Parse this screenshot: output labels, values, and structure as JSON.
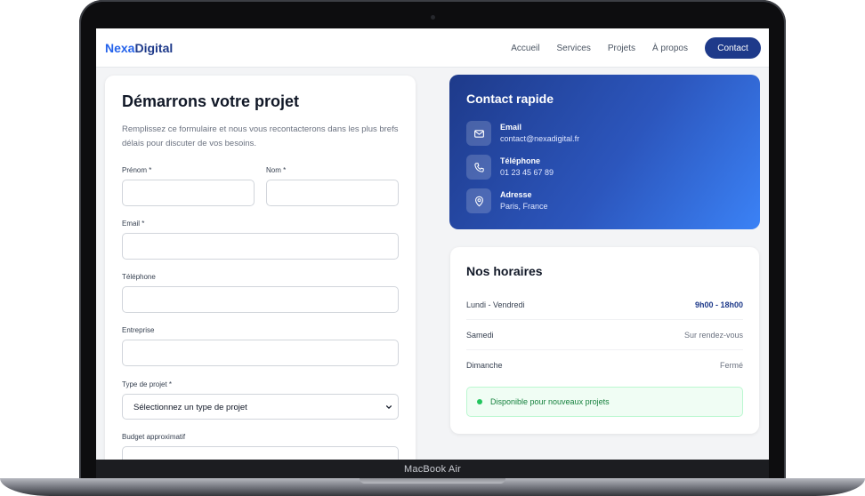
{
  "device": {
    "label": "MacBook Air"
  },
  "nav": {
    "logo_part1": "Nexa",
    "logo_part2": "Digital",
    "links": [
      "Accueil",
      "Services",
      "Projets",
      "À propos"
    ],
    "cta": "Contact"
  },
  "form": {
    "title": "Démarrons votre projet",
    "intro": "Remplissez ce formulaire et nous vous recontacterons dans les plus brefs délais pour discuter de vos besoins.",
    "fields": {
      "prenom": "Prénom *",
      "nom": "Nom *",
      "email": "Email *",
      "telephone": "Téléphone",
      "entreprise": "Entreprise",
      "type_projet": "Type de projet *",
      "budget": "Budget approximatif"
    },
    "type_projet_selected": "Sélectionnez un type de projet"
  },
  "contact": {
    "title": "Contact rapide",
    "items": [
      {
        "icon": "mail-icon",
        "label": "Email",
        "value": "contact@nexadigital.fr"
      },
      {
        "icon": "phone-icon",
        "label": "Téléphone",
        "value": "01 23 45 67 89"
      },
      {
        "icon": "map-pin-icon",
        "label": "Adresse",
        "value": "Paris, France"
      }
    ]
  },
  "hours": {
    "title": "Nos horaires",
    "rows": [
      {
        "day": "Lundi - Vendredi",
        "time": "9h00 - 18h00"
      },
      {
        "day": "Samedi",
        "time": "Sur rendez-vous"
      },
      {
        "day": "Dimanche",
        "time": "Fermé"
      }
    ],
    "availability": "Disponible pour nouveaux projets"
  },
  "colors": {
    "brand_dark": "#1e3a8a",
    "brand_accent": "#2563eb",
    "gradient_end": "#3b82f6",
    "success": "#22c55e"
  }
}
